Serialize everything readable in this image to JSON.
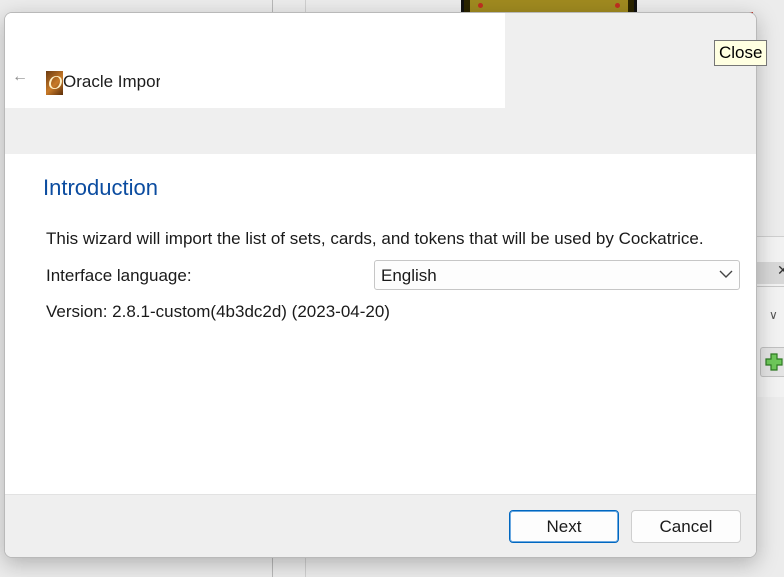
{
  "window": {
    "title": "Oracle Importer",
    "app_icon_letter": "O"
  },
  "tooltip": {
    "text": "Close"
  },
  "page": {
    "heading": "Introduction",
    "description": "This wizard will import the list of sets, cards, and tokens that will be used by Cockatrice.",
    "language_label": "Interface language:",
    "language_value": "English",
    "version": "Version: 2.8.1-custom(4b3dc2d) (2023-04-20)"
  },
  "buttons": {
    "next": "Next",
    "cancel": "Cancel"
  },
  "colors": {
    "heading": "#0b4ca0",
    "accent": "#0067c0",
    "close_red": "#c42b1c"
  }
}
